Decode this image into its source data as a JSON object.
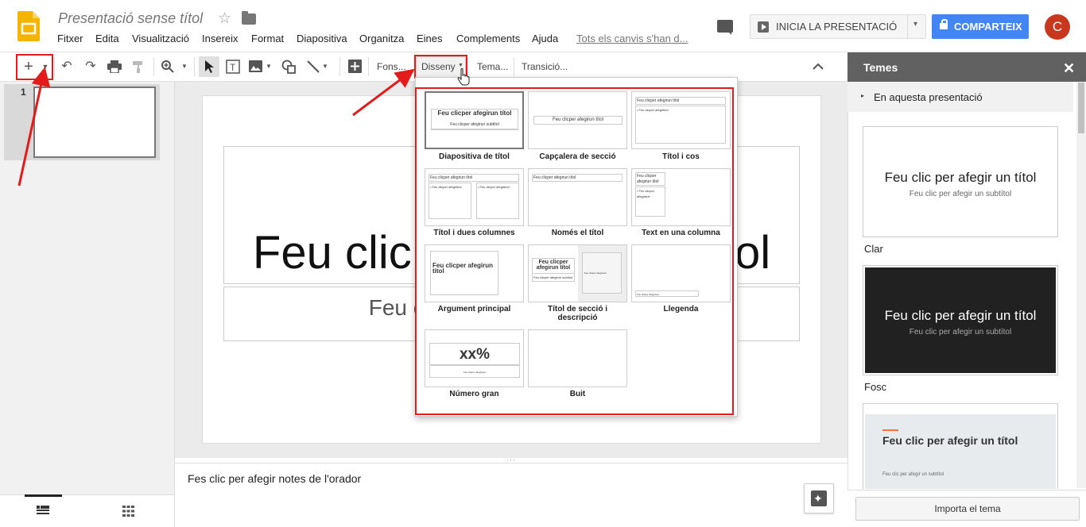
{
  "app": {
    "title": "Presentació sense títol"
  },
  "header": {
    "menu": [
      "Fitxer",
      "Edita",
      "Visualització",
      "Insereix",
      "Format",
      "Diapositiva",
      "Organitza",
      "Eines",
      "Complements",
      "Ajuda"
    ],
    "saved_status": "Tots els canvis s'han d...",
    "present_label": "INICIA LA PRESENTACIÓ",
    "share_label": "COMPARTEIX",
    "avatar_letter": "C"
  },
  "toolbar": {
    "new_slide": "+",
    "background_label": "Fons...",
    "layout_label": "Disseny",
    "theme_label": "Tema...",
    "transition_label": "Transició..."
  },
  "filmstrip": {
    "slide_number": "1"
  },
  "slide": {
    "title_placeholder": "Feu clic per afegir un títol",
    "subtitle_placeholder": "Feu clic per afegir un subtítol"
  },
  "notes": {
    "placeholder": "Fes clic per afegir notes de l'orador"
  },
  "layouts": [
    {
      "label": "Diapositiva de títol",
      "mini_title": "Feu clicper afegirun títol",
      "mini_sub": "Feu clicper afegirun subtítol",
      "selected": true
    },
    {
      "label": "Capçalera de secció",
      "mini_title": "Feu clicper afegirun títol"
    },
    {
      "label": "Títol i cos",
      "mini_title": "Feu clicper afegirun títol",
      "mini_body": "• Feu clicper afegirtext"
    },
    {
      "label": "Títol i dues columnes",
      "mini_title": "Feu clicper afegirun títol",
      "mini_body": "• Feu clicper afegirtext"
    },
    {
      "label": "Només el títol",
      "mini_title": "Feu clicper afegirun títol"
    },
    {
      "label": "Text en una columna",
      "mini_title": "Feu clicper afegirun títol",
      "mini_body": "• Feu clicper afegirtext"
    },
    {
      "label": "Argument principal",
      "mini_title": "Feu clicper afegirun títol"
    },
    {
      "label": "Títol de secció i descripció",
      "mini_title": "Feu clicper afegirun títol",
      "mini_sub": "Feu clicper afegirun subtítol",
      "mini_body": "Feu clicper afegirtext"
    },
    {
      "label": "Llegenda",
      "mini_body": "Feu clicper afegirtext"
    },
    {
      "label": "Número gran",
      "mini_big": "xx%",
      "mini_body": "Feu clicper afegirtext"
    },
    {
      "label": "Buit"
    }
  ],
  "panel": {
    "title": "Temes",
    "section": "En aquesta presentació",
    "themes": [
      {
        "name": "Clar",
        "title": "Feu clic per afegir un títol",
        "subtitle": "Feu clic per afegir un subtítol"
      },
      {
        "name": "Fosc",
        "title": "Feu clic per afegir un títol",
        "subtitle": "Feu clic per afegir un subtítol"
      },
      {
        "name": "",
        "title": "Feu clic per afegir un títol",
        "subtitle": "Feu clic per afegir un subtítol"
      }
    ],
    "import_label": "Importa el tema"
  },
  "colors": {
    "accent": "#4285f4",
    "annotation": "#e31b1b",
    "panel_header": "#616161",
    "avatar": "#c9371f",
    "logo": "#f4b400"
  }
}
